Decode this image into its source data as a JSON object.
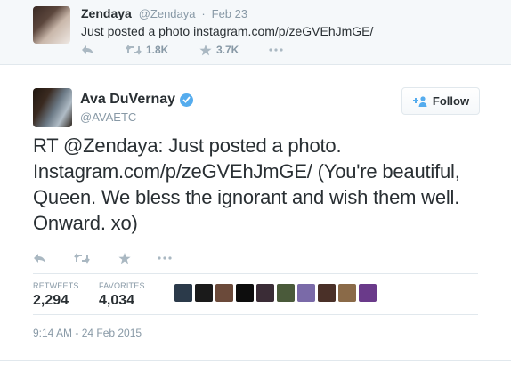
{
  "parent_tweet": {
    "name": "Zendaya",
    "handle": "@Zendaya",
    "separator": "·",
    "time": "Feb 23",
    "text": "Just posted a photo instagram.com/p/zeGVEhJmGE/",
    "retweets": "1.8K",
    "favorites": "3.7K"
  },
  "main_tweet": {
    "name": "Ava DuVernay",
    "handle": "@AVAETC",
    "follow_label": "Follow",
    "text": "RT @Zendaya: Just posted a photo. Instagram.com/p/zeGVEhJmGE/ (You're beautiful, Queen. We bless the ignorant and wish them well. Onward. xo)",
    "stats": {
      "retweets_label": "RETWEETS",
      "retweets_value": "2,294",
      "favorites_label": "FAVORITES",
      "favorites_value": "4,034"
    },
    "favoriter_colors": [
      "#2b3a4a",
      "#1a1a1a",
      "#6b4a3a",
      "#0d0d0d",
      "#3a2c36",
      "#4a5a3a",
      "#7a6aa8",
      "#4a3028",
      "#8a6a48",
      "#6a3a8a"
    ],
    "timestamp": "9:14 AM - 24 Feb 2015"
  },
  "colors": {
    "accent": "#55acee",
    "muted": "#8899a6",
    "action_icon": "#aab8c2"
  }
}
